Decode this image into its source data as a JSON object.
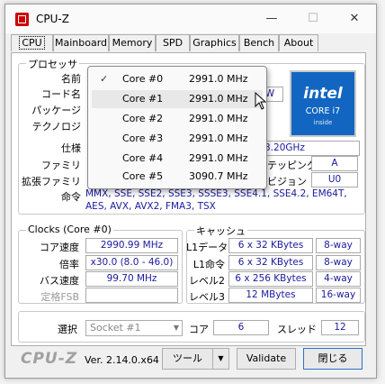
{
  "window": {
    "title": "CPU-Z",
    "minimize": "—",
    "maximize": "☐",
    "close": "✕"
  },
  "tabs": [
    "CPU",
    "Mainboard",
    "Memory",
    "SPD",
    "Graphics",
    "Bench",
    "About"
  ],
  "processor": {
    "group_label": "プロセッサ",
    "labels": {
      "name": "名前",
      "codename": "コード名",
      "package": "パッケージ",
      "technology": "テクノロジ",
      "spec": "仕様",
      "family": "ファミリ",
      "ext_family": "拡張ファミリ",
      "instructions": "命令"
    },
    "spec_value": "3.20GHz",
    "stepping_label": "ステッピング",
    "stepping_value": "A",
    "revision_label": "リビジョン",
    "revision_value": "U0",
    "codename_tail": "W",
    "instructions_value": "MMX, SSE, SSE2, SSE3, SSSE3, SSE4.1, SSE4.2, EM64T, AES, AVX, AVX2, FMA3, TSX",
    "logo": {
      "brand": "intel",
      "line": "CORE i7",
      "inside": "inside"
    }
  },
  "dropdown": {
    "check": "✓",
    "items": [
      {
        "name": "Core #0",
        "freq": "2991.0 MHz"
      },
      {
        "name": "Core #1",
        "freq": "2991.0 MHz"
      },
      {
        "name": "Core #2",
        "freq": "2991.0 MHz"
      },
      {
        "name": "Core #3",
        "freq": "2991.0 MHz"
      },
      {
        "name": "Core #4",
        "freq": "2991.0 MHz"
      },
      {
        "name": "Core #5",
        "freq": "3090.7 MHz"
      }
    ]
  },
  "clocks": {
    "group_label": "Clocks (Core #0)",
    "core_speed_label": "コア速度",
    "core_speed": "2990.99 MHz",
    "multiplier_label": "倍率",
    "multiplier": "x30.0 (8.0 - 46.0)",
    "bus_speed_label": "バス速度",
    "bus_speed": "99.70 MHz",
    "rated_fsb_label": "定格FSB",
    "rated_fsb": ""
  },
  "cache": {
    "group_label": "キャッシュ",
    "rows": [
      {
        "label": "L1データ",
        "size": "6 x 32 KBytes",
        "way": "8-way"
      },
      {
        "label": "L1命令",
        "size": "6 x 32 KBytes",
        "way": "8-way"
      },
      {
        "label": "レベル2",
        "size": "6 x 256 KBytes",
        "way": "4-way"
      },
      {
        "label": "レベル3",
        "size": "12 MBytes",
        "way": "16-way"
      }
    ]
  },
  "selection": {
    "label": "選択",
    "socket": "Socket #1",
    "cores_label": "コア",
    "cores": "6",
    "threads_label": "スレッド",
    "threads": "12"
  },
  "footer": {
    "logo": "CPU-Z",
    "version": "Ver. 2.14.0.x64",
    "tools": "ツール",
    "tools_arrow": "▼",
    "validate": "Validate",
    "close": "閉じる"
  }
}
